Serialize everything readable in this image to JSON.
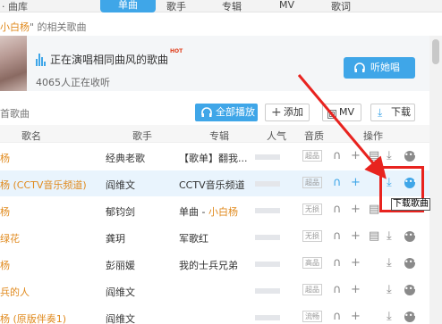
{
  "topbar": {
    "library": "· 曲库",
    "tabs": [
      "单曲",
      "歌手",
      "专辑",
      "MV",
      "歌词"
    ]
  },
  "context": {
    "singer": "小白杨",
    "suffix": "\" 的相关歌曲"
  },
  "banner": {
    "similar_text": "正在演唱相同曲风的歌曲",
    "badge": "HOT",
    "listeners": "4065人正在收听",
    "listen_button": "听她唱"
  },
  "section_title": "首歌曲",
  "toolbar": {
    "play_all": "全部播放",
    "add": "添加",
    "mv": "MV",
    "download": "下载"
  },
  "columns": {
    "song": "歌名",
    "singer": "歌手",
    "album": "专辑",
    "popularity": "人气",
    "quality": "音质",
    "ops": "操作"
  },
  "rows": [
    {
      "song": "杨",
      "singer": "经典老歌",
      "album": "【歌单】翻我...",
      "quality": "超品"
    },
    {
      "song": "杨 (CCTV音乐频道)",
      "singer": "阎维文",
      "album": "CCTV音乐频道",
      "quality": "超品"
    },
    {
      "song": "杨",
      "singer": "郁钧剑",
      "album_prefix": "单曲 - ",
      "album_highlight": "小白杨",
      "quality": "无损"
    },
    {
      "song": "绿花",
      "singer": "龚玥",
      "album": "军歌红",
      "quality": "无损"
    },
    {
      "song": "杨",
      "singer": "彭丽媛",
      "album": "我的士兵兄弟",
      "quality": "高品"
    },
    {
      "song": "兵的人",
      "singer": "阎维文",
      "album": "",
      "quality": "超品"
    },
    {
      "song": "杨 (原版伴奏1)",
      "singer": "阎维文",
      "album": "",
      "quality": "流畅"
    }
  ],
  "tooltip": "下载歌曲",
  "colors": {
    "accent": "#3fa6e8",
    "highlight": "#e08a1e",
    "annotation": "#e8231f"
  }
}
